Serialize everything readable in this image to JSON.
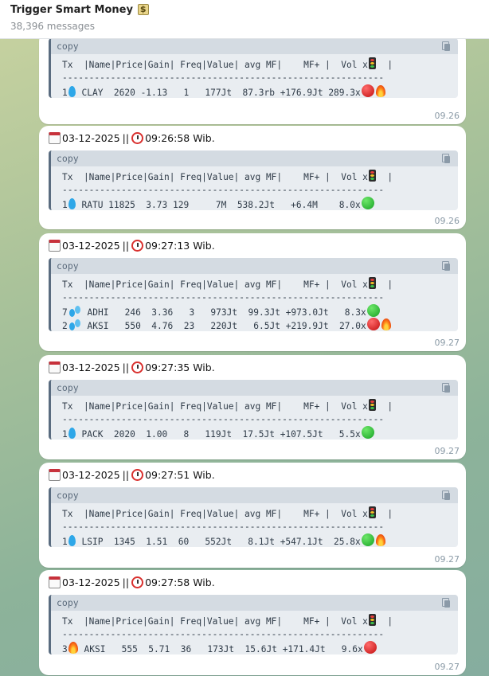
{
  "header": {
    "title": "Trigger Smart Money",
    "title_icon": "money-icon",
    "subtitle": "38,396 messages"
  },
  "code_lang": "copy",
  "table": {
    "header_line": "Tx  |Name|Price|Gain| Freq|Value| avg MF|    MF+ |  Vol x",
    "header_tail": "  |",
    "divider": "------------------------------------------------------------"
  },
  "messages": [
    {
      "partial": true,
      "rows": [
        {
          "tx": "1",
          "icon": "droplet-icon",
          "text": " CLAY  2620 -1.13   1   177Jt  87.3rb +176.9Jt 289.3x",
          "marks": [
            "red-circle-icon",
            "fire-icon"
          ]
        }
      ],
      "time": "09.26"
    },
    {
      "date": "03-12-2025",
      "sep": "||",
      "clock_time": "09:26:58 Wib.",
      "rows": [
        {
          "tx": "1",
          "icon": "droplet-icon",
          "text": " RATU 11825  3.73 129     7M  538.2Jt   +6.4M    8.0x",
          "marks": [
            "green-circle-icon"
          ]
        }
      ],
      "time": "09.26"
    },
    {
      "date": "03-12-2025",
      "sep": "||",
      "clock_time": "09:27:13 Wib.",
      "rows": [
        {
          "tx": "7",
          "icon": "sweat-droplets-icon",
          "text": " ADHI   246  3.36   3   973Jt  99.3Jt +973.0Jt   8.3x",
          "marks": [
            "green-circle-icon"
          ]
        },
        {
          "tx": "2",
          "icon": "sweat-droplets-icon",
          "text": " AKSI   550  4.76  23   220Jt   6.5Jt +219.9Jt  27.0x",
          "marks": [
            "red-circle-icon",
            "fire-icon"
          ]
        }
      ],
      "time": "09.27"
    },
    {
      "date": "03-12-2025",
      "sep": "||",
      "clock_time": "09:27:35 Wib.",
      "rows": [
        {
          "tx": "1",
          "icon": "droplet-icon",
          "text": " PACK  2020  1.00   8   119Jt  17.5Jt +107.5Jt   5.5x",
          "marks": [
            "green-circle-icon"
          ]
        }
      ],
      "time": "09.27"
    },
    {
      "date": "03-12-2025",
      "sep": "||",
      "clock_time": "09:27:51 Wib.",
      "rows": [
        {
          "tx": "1",
          "icon": "droplet-icon",
          "text": " LSIP  1345  1.51  60   552Jt   8.1Jt +547.1Jt  25.8x",
          "marks": [
            "green-circle-icon",
            "fire-icon"
          ]
        }
      ],
      "time": "09.27"
    },
    {
      "date": "03-12-2025",
      "sep": "||",
      "clock_time": "09:27:58 Wib.",
      "rows": [
        {
          "tx": "3",
          "icon": "fire-icon",
          "text": " AKSI   555  5.71  36   173Jt  15.6Jt +171.4Jt   9.6x",
          "marks": [
            "red-circle-icon"
          ]
        }
      ],
      "time": "09.27"
    }
  ]
}
